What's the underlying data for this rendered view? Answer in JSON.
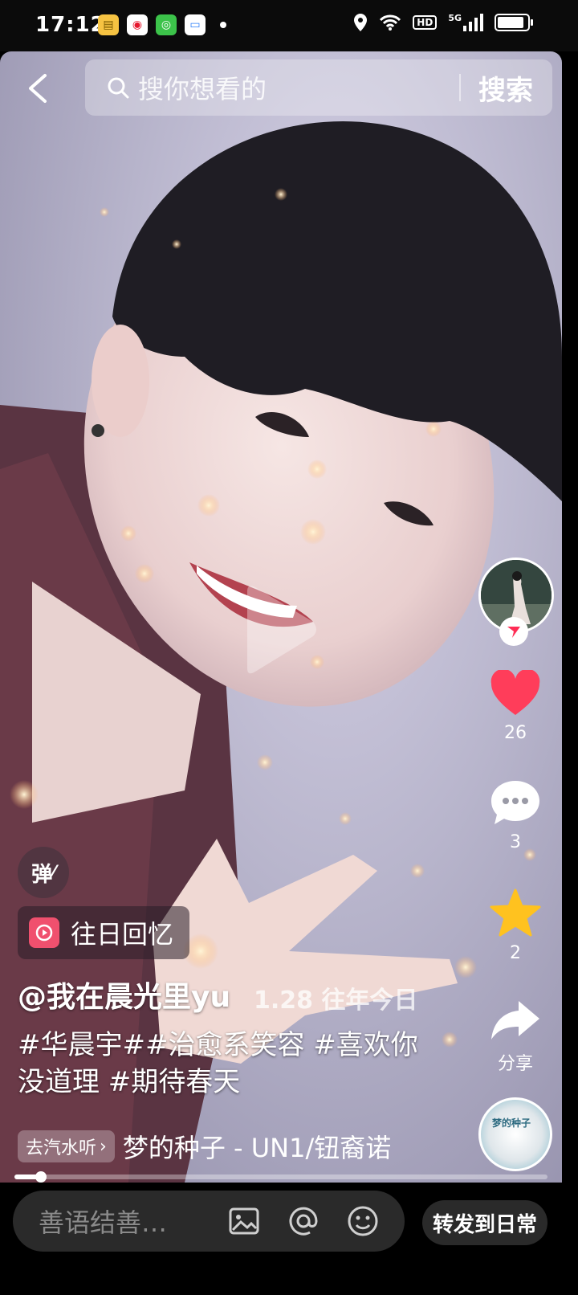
{
  "status_bar": {
    "time": "17:12",
    "network": "5G",
    "hd": "HD",
    "battery_level": 0.9,
    "app_icons": [
      "notes-app-icon",
      "weibo-app-icon",
      "green-app-icon",
      "wallet-app-icon"
    ]
  },
  "search": {
    "placeholder": "搜你想看的",
    "button": "搜索"
  },
  "sidebar": {
    "likes": "26",
    "comments": "3",
    "favorites": "2",
    "share_label": "分享"
  },
  "overlay": {
    "danmu": "弹",
    "memory_label": "往日回忆",
    "author": "@我在晨光里yu",
    "date_tag": "1.28 往年今日",
    "description": "#华晨宇##治愈系笑容 #喜欢你没道理 #期待春天",
    "music_chip": "去汽水听",
    "music_title": "梦的种子 - UN1/钮裔诺",
    "disc_label": "梦的种子",
    "progress": 0.05
  },
  "bottom_bar": {
    "comment_placeholder": "善语结善…",
    "forward_button": "转发到日常"
  },
  "colors": {
    "like": "#ff3d5a",
    "favorite": "#ffc21f",
    "follow": "#ff2d55",
    "memory_icon": "#f0506e"
  }
}
